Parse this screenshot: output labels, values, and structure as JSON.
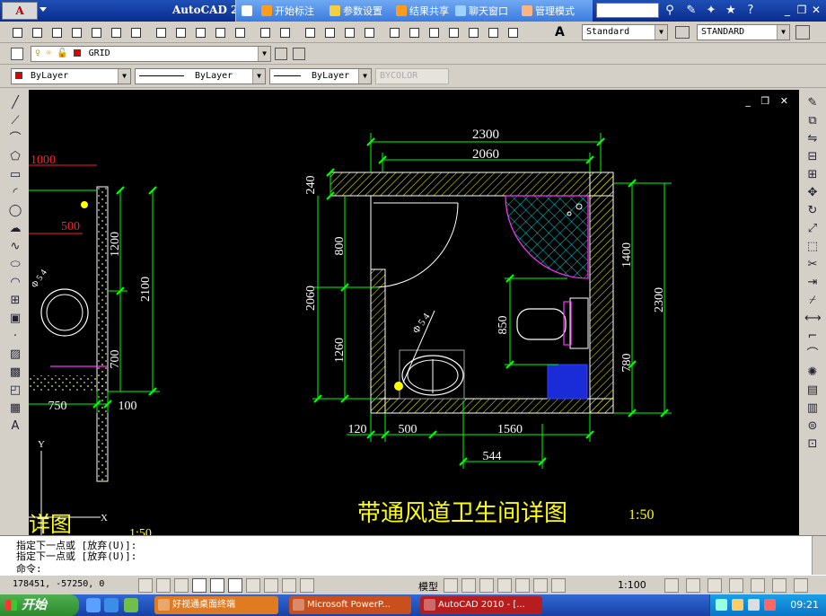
{
  "window": {
    "app_logo": "A",
    "title": "AutoCAD 2",
    "overlay_items": [
      {
        "label": "开始标注",
        "icon": "flag-icon",
        "color": "#ff9c1a"
      },
      {
        "label": "参数设置",
        "icon": "settings-icon",
        "color": "#f4d03f"
      },
      {
        "label": "结果共享",
        "icon": "share-icon",
        "color": "#ff9c1a"
      },
      {
        "label": "聊天窗口",
        "icon": "chat-icon",
        "color": "#9fd3ff"
      },
      {
        "label": "管理模式",
        "icon": "admin-icon",
        "color": "#ffb380"
      }
    ]
  },
  "layers": {
    "layer_name": "GRID",
    "text_style": "Standard",
    "dim_style": "STANDARD"
  },
  "properties": {
    "color": "ByLayer",
    "linetype": "ByLayer",
    "lineweight": "ByLayer",
    "plotstyle": "BYCOLOR",
    "color_swatch": "#e00000"
  },
  "drawing": {
    "left_panel": {
      "dim_1000": "1000",
      "dim_500": "500",
      "dim_1200": "1200",
      "dim_2100": "2100",
      "dim_700": "700",
      "dim_750": "750",
      "dim_100": "100",
      "partial_title": "详图",
      "partial_scale": "1:50",
      "pipe_label": "Φ 5 4",
      "axis_y": "Y",
      "axis_x": "X"
    },
    "plan": {
      "dim_top_outer": "2300",
      "dim_top_inner": "2060",
      "dim_240": "240",
      "dim_800": "800",
      "dim_2060_left": "2060",
      "dim_1260": "1260",
      "dim_850": "850",
      "dim_1400": "1400",
      "dim_2300_right": "2300",
      "dim_780": "780",
      "dim_120": "120",
      "dim_500": "500",
      "dim_1560": "1560",
      "dim_544": "544",
      "pipe_label": "Φ 5 4"
    },
    "title": "带通风道卫生间详图",
    "scale": "1:50"
  },
  "command": {
    "history": [
      "指定下一点或 [放弃(U)]:",
      "指定下一点或 [放弃(U)]:"
    ],
    "prompt": "命令:"
  },
  "status": {
    "coords": "178451, -57250, 0",
    "model": "模型",
    "annotation_scale": "1:100"
  },
  "taskbar": {
    "start": "开始",
    "tasks": [
      {
        "label": "好视通桌面终端",
        "color": "#e07b22"
      },
      {
        "label": "Microsoft PowerP...",
        "color": "#c9501d"
      },
      {
        "label": "AutoCAD 2010 - [...",
        "color": "#b81d1d"
      }
    ],
    "clock": "09:21"
  },
  "colors": {
    "dim_green": "#00ff00",
    "wall_yellow": "#ffff00",
    "text_white": "#ffffff",
    "accent_red": "#ff2020",
    "magenta": "#ff33ff",
    "cyan": "#00ffff"
  }
}
